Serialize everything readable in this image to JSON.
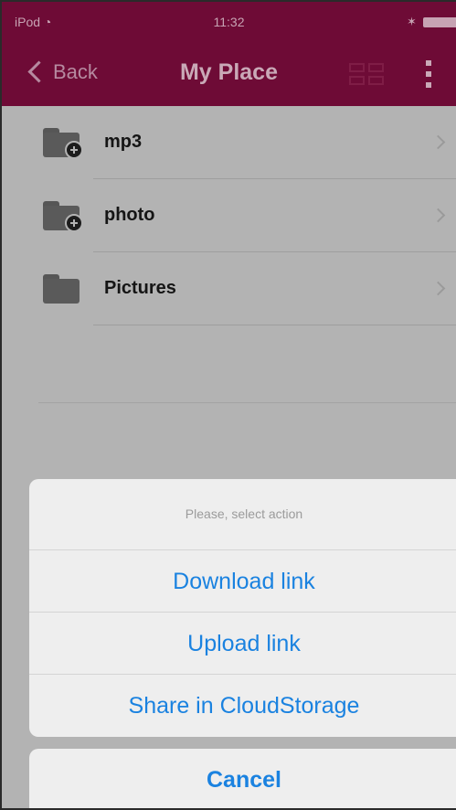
{
  "status_bar": {
    "carrier": "iPod",
    "wifi_icon": "wifi-icon",
    "time": "11:32",
    "bluetooth_icon": "bluetooth-icon",
    "battery_icon": "battery-icon"
  },
  "nav": {
    "back_label": "Back",
    "title": "My Place",
    "grid_icon": "grid-view-icon",
    "more_icon": "more-vertical-icon"
  },
  "file_list": {
    "items": [
      {
        "label": "mp3",
        "icon": "shared-folder-icon"
      },
      {
        "label": "photo",
        "icon": "shared-folder-icon"
      },
      {
        "label": "Pictures",
        "icon": "folder-icon"
      }
    ]
  },
  "action_sheet": {
    "title": "Please, select action",
    "options": [
      "Download link",
      "Upload link",
      "Share in CloudStorage"
    ],
    "cancel_label": "Cancel"
  },
  "colors": {
    "nav_background": "#6e0b36",
    "action_text": "#1a82e0",
    "dimmed_background": "#b3b3b3"
  }
}
